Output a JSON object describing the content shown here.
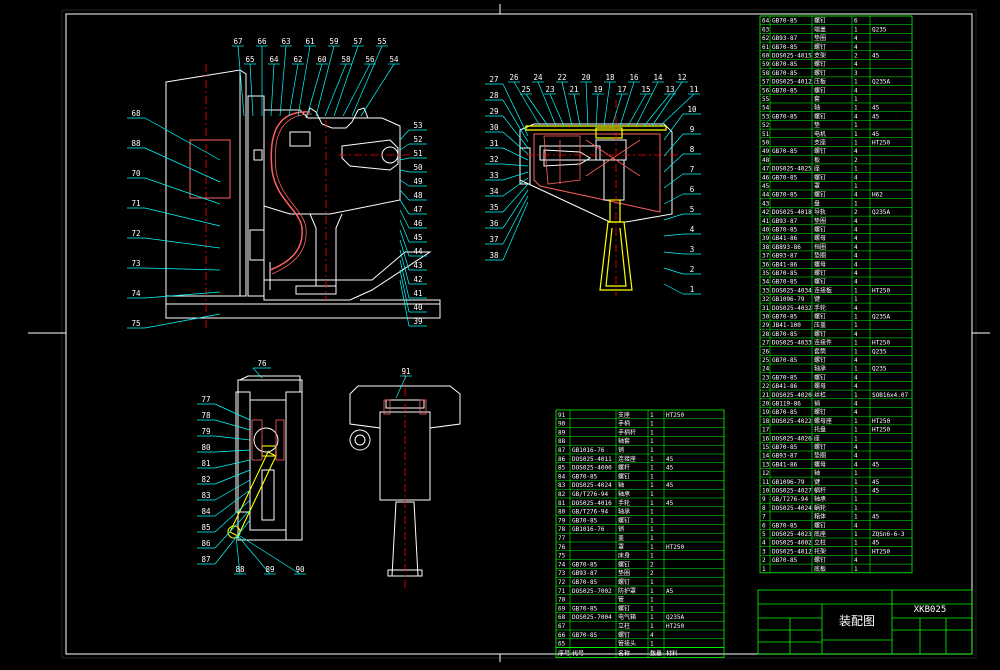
{
  "sheet": {
    "title_block": {
      "drawing_title": "装配图",
      "drawing_number": "XKB025"
    },
    "colors": {
      "background": "#000000",
      "frame": "#ffffff",
      "table_lines": "#00ff00",
      "table_text": "#ffffff",
      "outline": "#ffffff",
      "leader": "#00ffff",
      "center_line": "#ff0000",
      "tube": "#ff6060",
      "shaft": "#ffff00",
      "note": "#ffff00"
    }
  },
  "views": {
    "main": {
      "balloons_left": [
        "68",
        "88",
        "70",
        "71",
        "72",
        "73",
        "74",
        "75"
      ],
      "balloons_top": [
        "67",
        "65",
        "66",
        "64",
        "63",
        "62",
        "61",
        "60",
        "59",
        "58",
        "57",
        "56",
        "55",
        "54"
      ],
      "balloons_right": [
        "53",
        "52",
        "51",
        "50",
        "49",
        "48",
        "47",
        "46",
        "45",
        "44",
        "43",
        "42",
        "41",
        "40",
        "39"
      ]
    },
    "section": {
      "balloons_left": [
        "27",
        "28",
        "29",
        "30",
        "31",
        "32",
        "33",
        "34",
        "35",
        "36",
        "37",
        "38"
      ],
      "balloons_top": [
        "26",
        "25",
        "24",
        "23",
        "22",
        "21",
        "20",
        "19",
        "18",
        "17",
        "16",
        "15",
        "14",
        "13",
        "12",
        "11"
      ],
      "balloons_right": [
        "10",
        "9",
        "8",
        "7",
        "6",
        "5",
        "4",
        "3",
        "2",
        "1"
      ]
    },
    "detail_a": {
      "balloons": [
        "76",
        "77",
        "78",
        "79",
        "80",
        "81",
        "82",
        "83",
        "84",
        "85",
        "86",
        "87",
        "88",
        "89",
        "90"
      ]
    },
    "detail_b": {
      "balloons": [
        "91"
      ]
    }
  },
  "bom_right": [
    {
      "no": "64",
      "code": "GB70-85",
      "name": "螺钉",
      "qty": "6",
      "material": ""
    },
    {
      "no": "63",
      "code": "",
      "name": "端盖",
      "qty": "1",
      "material": "Q235"
    },
    {
      "no": "62",
      "code": "GB93-87",
      "name": "垫圈",
      "qty": "4",
      "material": ""
    },
    {
      "no": "61",
      "code": "GB70-85",
      "name": "螺钉",
      "qty": "4",
      "material": ""
    },
    {
      "no": "60",
      "code": "DOS025-4015",
      "name": "支架",
      "qty": "2",
      "material": "45"
    },
    {
      "no": "59",
      "code": "GB70-85",
      "name": "螺钉",
      "qty": "4",
      "material": ""
    },
    {
      "no": "58",
      "code": "GB70-85",
      "name": "螺钉",
      "qty": "3",
      "material": ""
    },
    {
      "no": "57",
      "code": "DOS025-4012",
      "name": "压板",
      "qty": "1",
      "material": "Q235A"
    },
    {
      "no": "56",
      "code": "GB70-85",
      "name": "螺钉",
      "qty": "4",
      "material": ""
    },
    {
      "no": "55",
      "code": "",
      "name": "套",
      "qty": "1",
      "material": ""
    },
    {
      "no": "54",
      "code": "",
      "name": "轴",
      "qty": "1",
      "material": "45"
    },
    {
      "no": "53",
      "code": "GB70-85",
      "name": "螺钉",
      "qty": "4",
      "material": "45"
    },
    {
      "no": "52",
      "code": "",
      "name": "垫",
      "qty": "1",
      "material": ""
    },
    {
      "no": "51",
      "code": "",
      "name": "电机",
      "qty": "1",
      "material": "45"
    },
    {
      "no": "50",
      "code": "",
      "name": "支座",
      "qty": "1",
      "material": "HT250"
    },
    {
      "no": "49",
      "code": "GB70-85",
      "name": "螺钉",
      "qty": "4",
      "material": ""
    },
    {
      "no": "48",
      "code": "",
      "name": "板",
      "qty": "2",
      "material": ""
    },
    {
      "no": "47",
      "code": "DOS025-4025",
      "name": "座",
      "qty": "1",
      "material": ""
    },
    {
      "no": "46",
      "code": "GB70-85",
      "name": "螺钉",
      "qty": "4",
      "material": ""
    },
    {
      "no": "45",
      "code": "",
      "name": "罩",
      "qty": "1",
      "material": ""
    },
    {
      "no": "44",
      "code": "GB70-85",
      "name": "螺钉",
      "qty": "4",
      "material": "H62"
    },
    {
      "no": "43",
      "code": "",
      "name": "盘",
      "qty": "1",
      "material": ""
    },
    {
      "no": "42",
      "code": "DOS025-4018",
      "name": "导轨",
      "qty": "2",
      "material": "Q235A"
    },
    {
      "no": "41",
      "code": "GB93-87",
      "name": "垫圈",
      "qty": "4",
      "material": ""
    },
    {
      "no": "40",
      "code": "GB70-85",
      "name": "螺钉",
      "qty": "4",
      "material": ""
    },
    {
      "no": "39",
      "code": "GB41-86",
      "name": "螺母",
      "qty": "4",
      "material": ""
    },
    {
      "no": "38",
      "code": "GB893-86",
      "name": "挡圈",
      "qty": "4",
      "material": ""
    },
    {
      "no": "37",
      "code": "GB93-87",
      "name": "垫圈",
      "qty": "4",
      "material": ""
    },
    {
      "no": "36",
      "code": "GB41-86",
      "name": "螺母",
      "qty": "4",
      "material": ""
    },
    {
      "no": "35",
      "code": "GB70-85",
      "name": "螺钉",
      "qty": "4",
      "material": ""
    },
    {
      "no": "34",
      "code": "GB70-85",
      "name": "螺钉",
      "qty": "4",
      "material": ""
    },
    {
      "no": "33",
      "code": "DOS025-4034",
      "name": "连接板",
      "qty": "1",
      "material": "HT250"
    },
    {
      "no": "32",
      "code": "GB1096-79",
      "name": "键",
      "qty": "1",
      "material": ""
    },
    {
      "no": "31",
      "code": "DOS025-4032",
      "name": "手轮",
      "qty": "4",
      "material": ""
    },
    {
      "no": "30",
      "code": "GB70-85",
      "name": "螺钉",
      "qty": "1",
      "material": "Q235A"
    },
    {
      "no": "29",
      "code": "JB41-100",
      "name": "压盖",
      "qty": "1",
      "material": ""
    },
    {
      "no": "28",
      "code": "GB70-85",
      "name": "螺钉",
      "qty": "4",
      "material": ""
    },
    {
      "no": "27",
      "code": "DOS025-4033",
      "name": "连接件",
      "qty": "1",
      "material": "HT250"
    },
    {
      "no": "26",
      "code": "",
      "name": "套筒",
      "qty": "1",
      "material": "Q235"
    },
    {
      "no": "25",
      "code": "GB70-85",
      "name": "螺钉",
      "qty": "4",
      "material": ""
    },
    {
      "no": "24",
      "code": "",
      "name": "轴承",
      "qty": "1",
      "material": "Q235"
    },
    {
      "no": "23",
      "code": "GB70-85",
      "name": "螺钉",
      "qty": "4",
      "material": ""
    },
    {
      "no": "22",
      "code": "GB41-86",
      "name": "螺母",
      "qty": "4",
      "material": ""
    },
    {
      "no": "21",
      "code": "DOS025-4020",
      "name": "丝杠",
      "qty": "1",
      "material": "SOB16x4.07"
    },
    {
      "no": "20",
      "code": "GB119-86",
      "name": "销",
      "qty": "4",
      "material": ""
    },
    {
      "no": "19",
      "code": "GB70-85",
      "name": "螺钉",
      "qty": "4",
      "material": ""
    },
    {
      "no": "18",
      "code": "DOS025-4022",
      "name": "螺母座",
      "qty": "1",
      "material": "HT250"
    },
    {
      "no": "17",
      "code": "",
      "name": "托盘",
      "qty": "1",
      "material": "HT250"
    },
    {
      "no": "16",
      "code": "DOS025-4026",
      "name": "座",
      "qty": "1",
      "material": ""
    },
    {
      "no": "15",
      "code": "GB70-85",
      "name": "螺钉",
      "qty": "4",
      "material": ""
    },
    {
      "no": "14",
      "code": "GB93-87",
      "name": "垫圈",
      "qty": "4",
      "material": ""
    },
    {
      "no": "13",
      "code": "GB41-86",
      "name": "螺母",
      "qty": "4",
      "material": "45"
    },
    {
      "no": "12",
      "code": "",
      "name": "轴",
      "qty": "1",
      "material": ""
    },
    {
      "no": "11",
      "code": "GB1096-79",
      "name": "键",
      "qty": "1",
      "material": "45"
    },
    {
      "no": "10",
      "code": "DOS025-4027",
      "name": "蜗杆",
      "qty": "1",
      "material": "45"
    },
    {
      "no": "9",
      "code": "GB/T276-94",
      "name": "轴承",
      "qty": "1",
      "material": ""
    },
    {
      "no": "8",
      "code": "DOS025-4024",
      "name": "蜗轮",
      "qty": "1",
      "material": ""
    },
    {
      "no": "7",
      "code": "",
      "name": "箱体",
      "qty": "1",
      "material": "45"
    },
    {
      "no": "6",
      "code": "GB70-85",
      "name": "螺钉",
      "qty": "4",
      "material": ""
    },
    {
      "no": "5",
      "code": "DOS025-4023",
      "name": "底座",
      "qty": "1",
      "material": "ZQSn6-6-3"
    },
    {
      "no": "4",
      "code": "DOS025-4002",
      "name": "立柱",
      "qty": "1",
      "material": "45"
    },
    {
      "no": "3",
      "code": "DOS025-4012",
      "name": "托架",
      "qty": "1",
      "material": "HT250"
    },
    {
      "no": "2",
      "code": "GB70-85",
      "name": "螺钉",
      "qty": "4",
      "material": ""
    },
    {
      "no": "1",
      "code": "",
      "name": "底板",
      "qty": "1",
      "material": ""
    }
  ],
  "bom_left": [
    {
      "no": "91",
      "code": "",
      "name": "支座",
      "qty": "1",
      "material": "HT250"
    },
    {
      "no": "90",
      "code": "",
      "name": "手柄",
      "qty": "1",
      "material": ""
    },
    {
      "no": "89",
      "code": "",
      "name": "手柄杆",
      "qty": "1",
      "material": ""
    },
    {
      "no": "88",
      "code": "",
      "name": "轴套",
      "qty": "1",
      "material": ""
    },
    {
      "no": "87",
      "code": "GB1016-76",
      "name": "销",
      "qty": "1",
      "material": ""
    },
    {
      "no": "86",
      "code": "DOS025-4011",
      "name": "连接座",
      "qty": "1",
      "material": "45"
    },
    {
      "no": "85",
      "code": "DOS025-4000",
      "name": "螺杆",
      "qty": "1",
      "material": "45"
    },
    {
      "no": "84",
      "code": "GB70-85",
      "name": "螺钉",
      "qty": "1",
      "material": ""
    },
    {
      "no": "83",
      "code": "DOS025-4024",
      "name": "轴",
      "qty": "1",
      "material": "45"
    },
    {
      "no": "82",
      "code": "GB/T276-94",
      "name": "轴承",
      "qty": "1",
      "material": ""
    },
    {
      "no": "81",
      "code": "DOS025-4016",
      "name": "手轮",
      "qty": "1",
      "material": "45"
    },
    {
      "no": "80",
      "code": "GB/T276-94",
      "name": "轴承",
      "qty": "1",
      "material": ""
    },
    {
      "no": "79",
      "code": "GB70-85",
      "name": "螺钉",
      "qty": "1",
      "material": ""
    },
    {
      "no": "78",
      "code": "GB1016-76",
      "name": "销",
      "qty": "1",
      "material": ""
    },
    {
      "no": "77",
      "code": "",
      "name": "盖",
      "qty": "1",
      "material": ""
    },
    {
      "no": "76",
      "code": "",
      "name": "罩",
      "qty": "1",
      "material": "HT250"
    },
    {
      "no": "75",
      "code": "",
      "name": "床身",
      "qty": "1",
      "material": ""
    },
    {
      "no": "74",
      "code": "GB70-85",
      "name": "螺钉",
      "qty": "2",
      "material": ""
    },
    {
      "no": "73",
      "code": "GB93-87",
      "name": "垫圈",
      "qty": "2",
      "material": ""
    },
    {
      "no": "72",
      "code": "GB70-85",
      "name": "螺钉",
      "qty": "1",
      "material": ""
    },
    {
      "no": "71",
      "code": "DOS025-7002",
      "name": "防护罩",
      "qty": "1",
      "material": "A5"
    },
    {
      "no": "70",
      "code": "",
      "name": "管",
      "qty": "1",
      "material": ""
    },
    {
      "no": "69",
      "code": "GB70-85",
      "name": "螺钉",
      "qty": "1",
      "material": ""
    },
    {
      "no": "68",
      "code": "DOS025-7004",
      "name": "电气箱",
      "qty": "1",
      "material": "Q235A"
    },
    {
      "no": "67",
      "code": "",
      "name": "立柱",
      "qty": "1",
      "material": "HT250"
    },
    {
      "no": "66",
      "code": "GB70-85",
      "name": "螺钉",
      "qty": "4",
      "material": ""
    },
    {
      "no": "65",
      "code": "",
      "name": "管接头",
      "qty": "1",
      "material": ""
    }
  ],
  "bom_header": {
    "no": "序号",
    "code": "代号",
    "name": "名称",
    "qty": "数量",
    "material": "材料"
  }
}
